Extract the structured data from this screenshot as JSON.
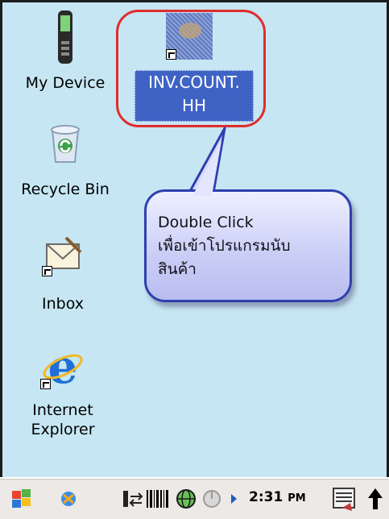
{
  "desktop": {
    "icons": [
      {
        "name": "My Device",
        "icon": "pda-device-icon"
      },
      {
        "name": "Recycle Bin",
        "icon": "recycle-bin-icon"
      },
      {
        "name": "Inbox",
        "icon": "inbox-mail-icon"
      },
      {
        "name": "Internet\nExplorer",
        "icon": "internet-explorer-icon"
      }
    ],
    "selected_app": {
      "name": "INV.COUNT.\nHH",
      "icon": "inv-count-app-icon"
    }
  },
  "callout": {
    "text": "Double Click\nเพื่อเข้าโปรแกรมนับ\nสินค้า"
  },
  "taskbar": {
    "clock": "2:31",
    "ampm": "PM",
    "icons": [
      "start-windows-flag-icon",
      "sync-icon",
      "connection-icon",
      "barcode-scanner-icon",
      "wireless-globe-icon",
      "battery-icon",
      "keyboard-input-icon",
      "up-arrow-icon"
    ]
  },
  "colors": {
    "desktop_bg": "#c6e6f3",
    "highlight_ring": "#e02c2c",
    "selection": "#3f63c5",
    "callout_border": "#2f3fae"
  }
}
